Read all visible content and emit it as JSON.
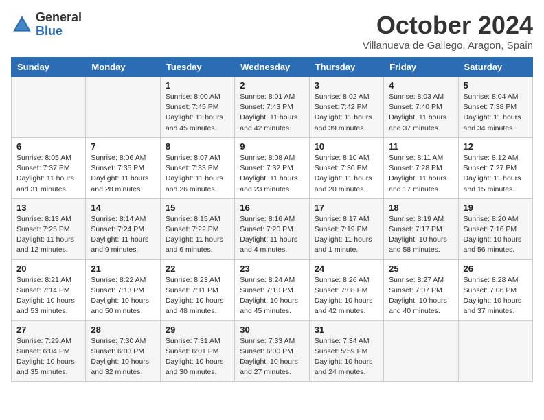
{
  "header": {
    "logo": {
      "general": "General",
      "blue": "Blue"
    },
    "title": "October 2024",
    "location": "Villanueva de Gallego, Aragon, Spain"
  },
  "days_of_week": [
    "Sunday",
    "Monday",
    "Tuesday",
    "Wednesday",
    "Thursday",
    "Friday",
    "Saturday"
  ],
  "weeks": [
    [
      {
        "day": "",
        "sunrise": "",
        "sunset": "",
        "daylight": ""
      },
      {
        "day": "",
        "sunrise": "",
        "sunset": "",
        "daylight": ""
      },
      {
        "day": "1",
        "sunrise": "Sunrise: 8:00 AM",
        "sunset": "Sunset: 7:45 PM",
        "daylight": "Daylight: 11 hours and 45 minutes."
      },
      {
        "day": "2",
        "sunrise": "Sunrise: 8:01 AM",
        "sunset": "Sunset: 7:43 PM",
        "daylight": "Daylight: 11 hours and 42 minutes."
      },
      {
        "day": "3",
        "sunrise": "Sunrise: 8:02 AM",
        "sunset": "Sunset: 7:42 PM",
        "daylight": "Daylight: 11 hours and 39 minutes."
      },
      {
        "day": "4",
        "sunrise": "Sunrise: 8:03 AM",
        "sunset": "Sunset: 7:40 PM",
        "daylight": "Daylight: 11 hours and 37 minutes."
      },
      {
        "day": "5",
        "sunrise": "Sunrise: 8:04 AM",
        "sunset": "Sunset: 7:38 PM",
        "daylight": "Daylight: 11 hours and 34 minutes."
      }
    ],
    [
      {
        "day": "6",
        "sunrise": "Sunrise: 8:05 AM",
        "sunset": "Sunset: 7:37 PM",
        "daylight": "Daylight: 11 hours and 31 minutes."
      },
      {
        "day": "7",
        "sunrise": "Sunrise: 8:06 AM",
        "sunset": "Sunset: 7:35 PM",
        "daylight": "Daylight: 11 hours and 28 minutes."
      },
      {
        "day": "8",
        "sunrise": "Sunrise: 8:07 AM",
        "sunset": "Sunset: 7:33 PM",
        "daylight": "Daylight: 11 hours and 26 minutes."
      },
      {
        "day": "9",
        "sunrise": "Sunrise: 8:08 AM",
        "sunset": "Sunset: 7:32 PM",
        "daylight": "Daylight: 11 hours and 23 minutes."
      },
      {
        "day": "10",
        "sunrise": "Sunrise: 8:10 AM",
        "sunset": "Sunset: 7:30 PM",
        "daylight": "Daylight: 11 hours and 20 minutes."
      },
      {
        "day": "11",
        "sunrise": "Sunrise: 8:11 AM",
        "sunset": "Sunset: 7:28 PM",
        "daylight": "Daylight: 11 hours and 17 minutes."
      },
      {
        "day": "12",
        "sunrise": "Sunrise: 8:12 AM",
        "sunset": "Sunset: 7:27 PM",
        "daylight": "Daylight: 11 hours and 15 minutes."
      }
    ],
    [
      {
        "day": "13",
        "sunrise": "Sunrise: 8:13 AM",
        "sunset": "Sunset: 7:25 PM",
        "daylight": "Daylight: 11 hours and 12 minutes."
      },
      {
        "day": "14",
        "sunrise": "Sunrise: 8:14 AM",
        "sunset": "Sunset: 7:24 PM",
        "daylight": "Daylight: 11 hours and 9 minutes."
      },
      {
        "day": "15",
        "sunrise": "Sunrise: 8:15 AM",
        "sunset": "Sunset: 7:22 PM",
        "daylight": "Daylight: 11 hours and 6 minutes."
      },
      {
        "day": "16",
        "sunrise": "Sunrise: 8:16 AM",
        "sunset": "Sunset: 7:20 PM",
        "daylight": "Daylight: 11 hours and 4 minutes."
      },
      {
        "day": "17",
        "sunrise": "Sunrise: 8:17 AM",
        "sunset": "Sunset: 7:19 PM",
        "daylight": "Daylight: 11 hours and 1 minute."
      },
      {
        "day": "18",
        "sunrise": "Sunrise: 8:19 AM",
        "sunset": "Sunset: 7:17 PM",
        "daylight": "Daylight: 10 hours and 58 minutes."
      },
      {
        "day": "19",
        "sunrise": "Sunrise: 8:20 AM",
        "sunset": "Sunset: 7:16 PM",
        "daylight": "Daylight: 10 hours and 56 minutes."
      }
    ],
    [
      {
        "day": "20",
        "sunrise": "Sunrise: 8:21 AM",
        "sunset": "Sunset: 7:14 PM",
        "daylight": "Daylight: 10 hours and 53 minutes."
      },
      {
        "day": "21",
        "sunrise": "Sunrise: 8:22 AM",
        "sunset": "Sunset: 7:13 PM",
        "daylight": "Daylight: 10 hours and 50 minutes."
      },
      {
        "day": "22",
        "sunrise": "Sunrise: 8:23 AM",
        "sunset": "Sunset: 7:11 PM",
        "daylight": "Daylight: 10 hours and 48 minutes."
      },
      {
        "day": "23",
        "sunrise": "Sunrise: 8:24 AM",
        "sunset": "Sunset: 7:10 PM",
        "daylight": "Daylight: 10 hours and 45 minutes."
      },
      {
        "day": "24",
        "sunrise": "Sunrise: 8:26 AM",
        "sunset": "Sunset: 7:08 PM",
        "daylight": "Daylight: 10 hours and 42 minutes."
      },
      {
        "day": "25",
        "sunrise": "Sunrise: 8:27 AM",
        "sunset": "Sunset: 7:07 PM",
        "daylight": "Daylight: 10 hours and 40 minutes."
      },
      {
        "day": "26",
        "sunrise": "Sunrise: 8:28 AM",
        "sunset": "Sunset: 7:06 PM",
        "daylight": "Daylight: 10 hours and 37 minutes."
      }
    ],
    [
      {
        "day": "27",
        "sunrise": "Sunrise: 7:29 AM",
        "sunset": "Sunset: 6:04 PM",
        "daylight": "Daylight: 10 hours and 35 minutes."
      },
      {
        "day": "28",
        "sunrise": "Sunrise: 7:30 AM",
        "sunset": "Sunset: 6:03 PM",
        "daylight": "Daylight: 10 hours and 32 minutes."
      },
      {
        "day": "29",
        "sunrise": "Sunrise: 7:31 AM",
        "sunset": "Sunset: 6:01 PM",
        "daylight": "Daylight: 10 hours and 30 minutes."
      },
      {
        "day": "30",
        "sunrise": "Sunrise: 7:33 AM",
        "sunset": "Sunset: 6:00 PM",
        "daylight": "Daylight: 10 hours and 27 minutes."
      },
      {
        "day": "31",
        "sunrise": "Sunrise: 7:34 AM",
        "sunset": "Sunset: 5:59 PM",
        "daylight": "Daylight: 10 hours and 24 minutes."
      },
      {
        "day": "",
        "sunrise": "",
        "sunset": "",
        "daylight": ""
      },
      {
        "day": "",
        "sunrise": "",
        "sunset": "",
        "daylight": ""
      }
    ]
  ]
}
